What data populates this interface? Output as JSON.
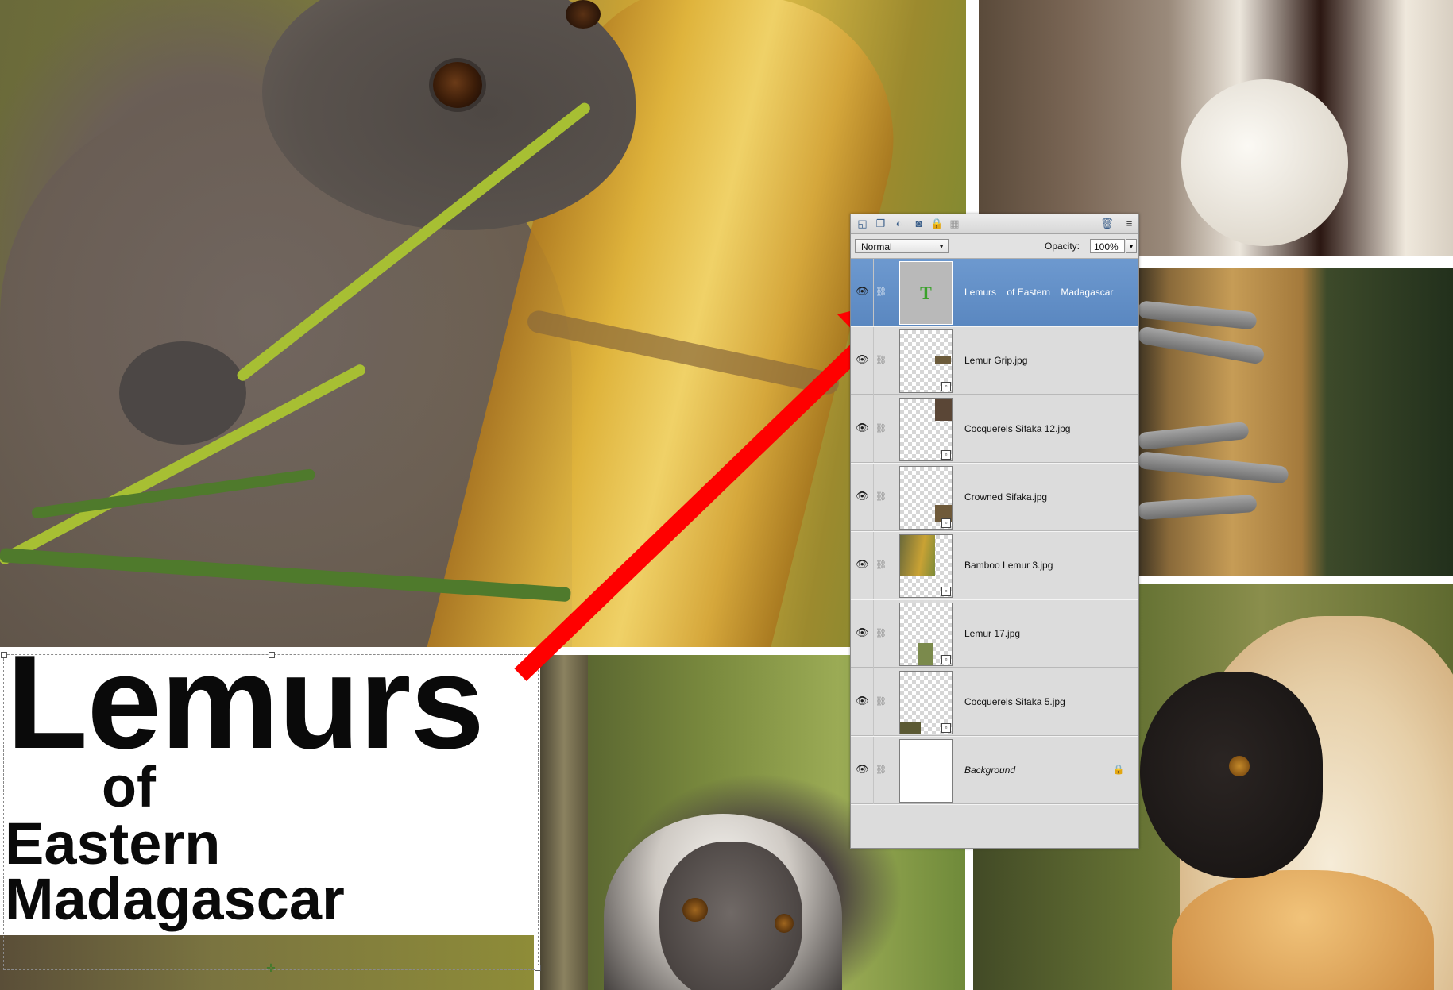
{
  "title_box": {
    "lines": [
      "Lemurs",
      "of",
      "Eastern",
      "Madagascar"
    ]
  },
  "layers_panel": {
    "toolbar_icons": [
      "new-layer-icon",
      "new-group-icon",
      "adjustment-layer-icon",
      "layer-mask-icon",
      "lock-all-icon",
      "lock-transparency-icon",
      "delete-layer-icon",
      "panel-menu-icon"
    ],
    "blend_mode": "Normal",
    "opacity_label": "Opacity:",
    "opacity_value": "100%",
    "layers": [
      {
        "name": "Lemurs    of Eastern    Madagascar",
        "kind": "type",
        "selected": true,
        "visible": true
      },
      {
        "name": "Lemur Grip.jpg",
        "kind": "smart-object",
        "selected": false,
        "visible": true
      },
      {
        "name": "Cocquerels Sifaka 12.jpg",
        "kind": "smart-object",
        "selected": false,
        "visible": true
      },
      {
        "name": "Crowned Sifaka.jpg",
        "kind": "smart-object",
        "selected": false,
        "visible": true
      },
      {
        "name": "Bamboo Lemur 3.jpg",
        "kind": "smart-object",
        "selected": false,
        "visible": true
      },
      {
        "name": "Lemur 17.jpg",
        "kind": "smart-object",
        "selected": false,
        "visible": true
      },
      {
        "name": "Cocquerels Sifaka 5.jpg",
        "kind": "smart-object",
        "selected": false,
        "visible": true
      },
      {
        "name": "Background",
        "kind": "background",
        "selected": false,
        "visible": true,
        "locked": true
      }
    ]
  },
  "colors": {
    "selected_row": "#5a87c0",
    "panel_bg": "#dcdcdc",
    "arrow": "#ff0000",
    "type_glyph": "#3aa12b"
  }
}
